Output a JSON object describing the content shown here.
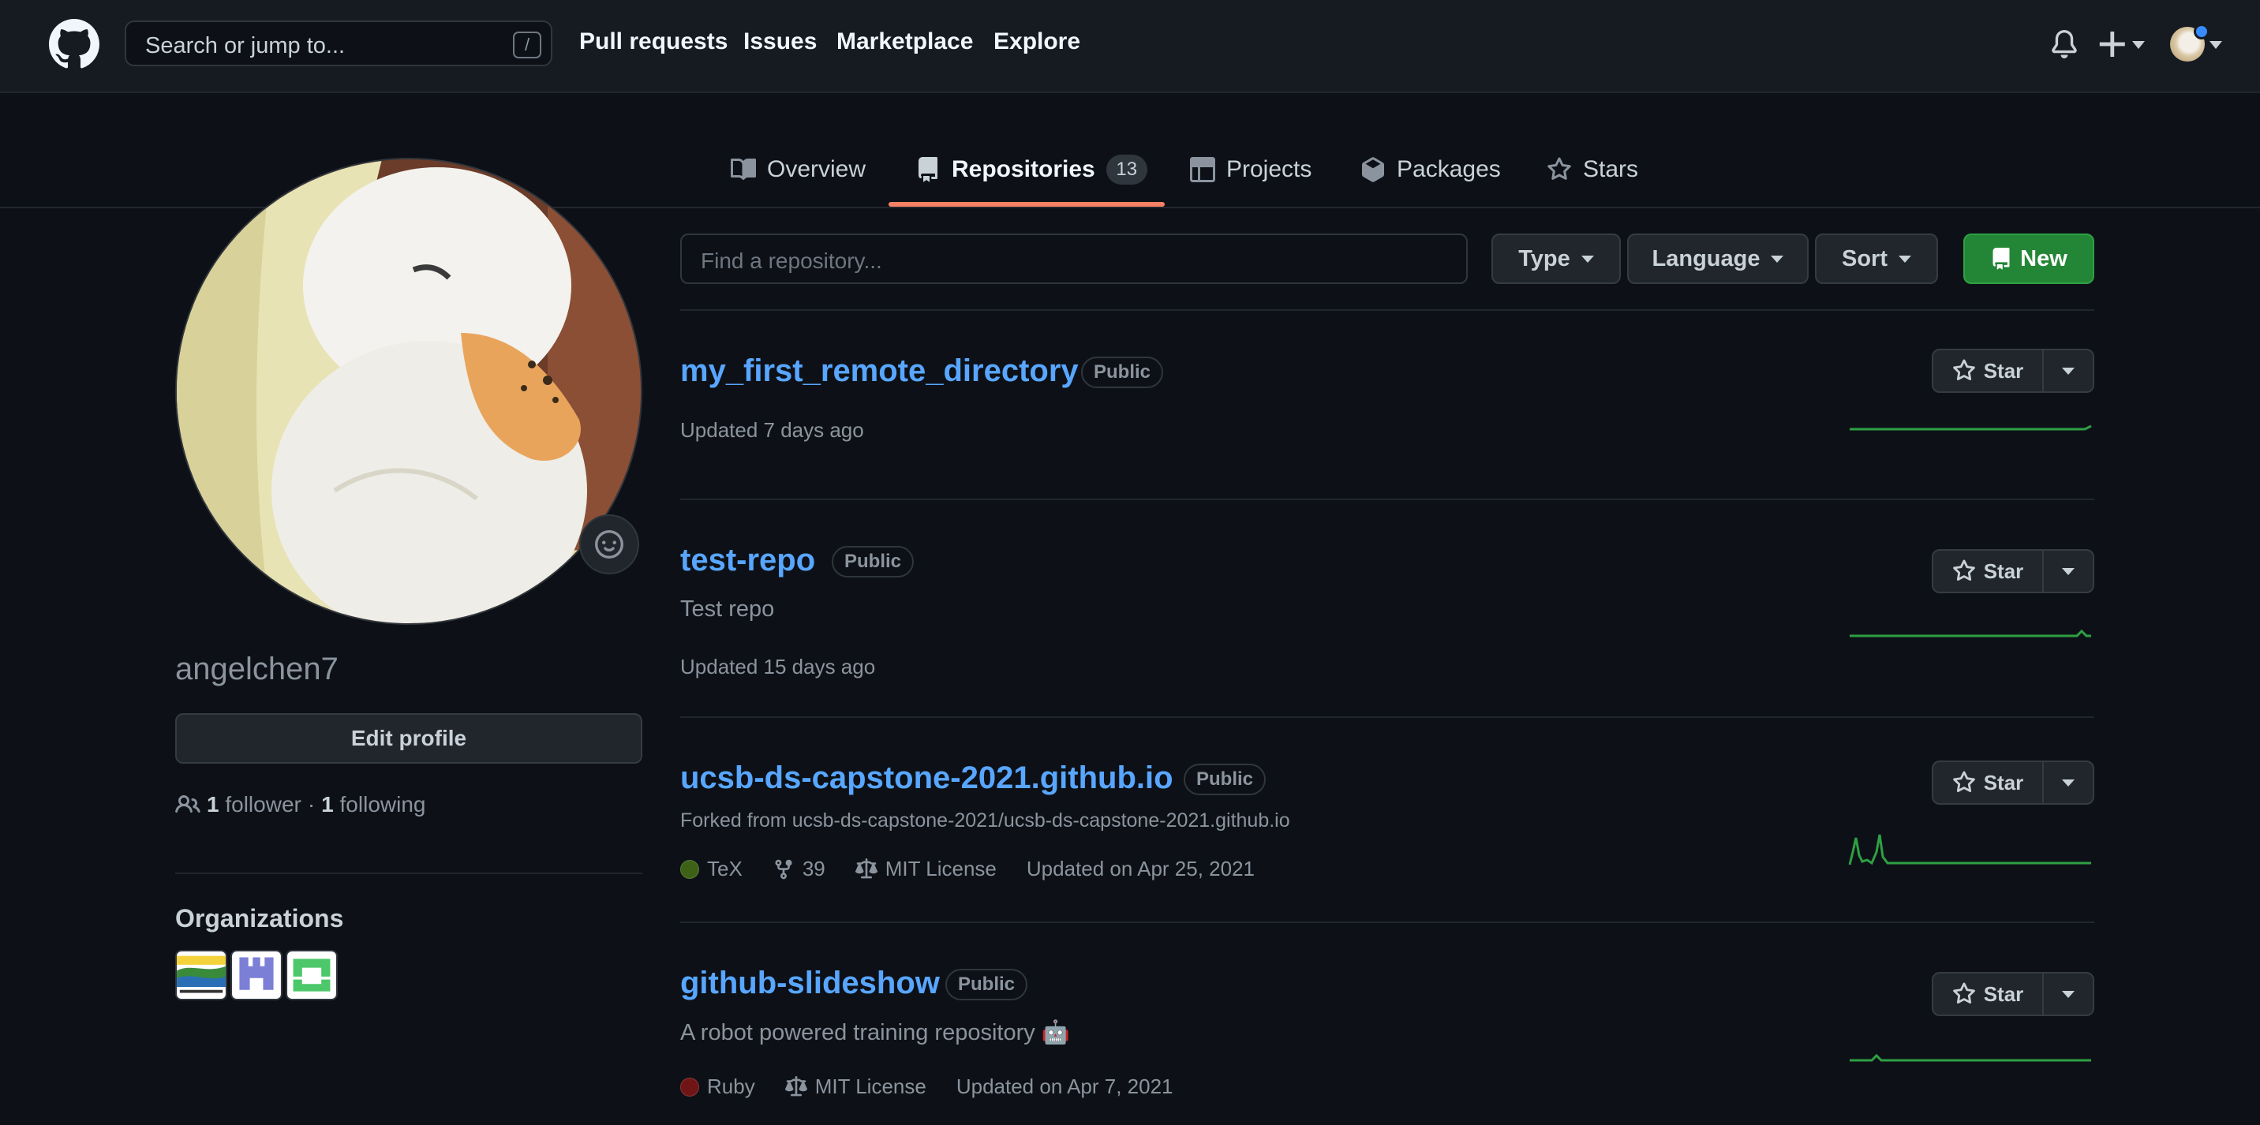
{
  "header": {
    "search_placeholder": "Search or jump to...",
    "search_shortcut": "/",
    "nav": [
      "Pull requests",
      "Issues",
      "Marketplace",
      "Explore"
    ]
  },
  "tabs": [
    {
      "label": "Overview",
      "icon": "book-icon"
    },
    {
      "label": "Repositories",
      "icon": "repo-icon",
      "count": "13",
      "active": true
    },
    {
      "label": "Projects",
      "icon": "table-icon"
    },
    {
      "label": "Packages",
      "icon": "package-icon"
    },
    {
      "label": "Stars",
      "icon": "star-icon"
    }
  ],
  "profile": {
    "username": "angelchen7",
    "edit_label": "Edit profile",
    "followers_count": "1",
    "followers_label": "follower",
    "separator": "·",
    "following_count": "1",
    "following_label": "following",
    "organizations_title": "Organizations"
  },
  "toolbar": {
    "find_placeholder": "Find a repository...",
    "type_label": "Type",
    "language_label": "Language",
    "sort_label": "Sort",
    "new_label": "New"
  },
  "repos": [
    {
      "name": "my_first_remote_directory",
      "visibility": "Public",
      "updated": "Updated 7 days ago",
      "star_label": "Star"
    },
    {
      "name": "test-repo",
      "visibility": "Public",
      "description": "Test repo",
      "updated": "Updated 15 days ago",
      "star_label": "Star"
    },
    {
      "name": "ucsb-ds-capstone-2021.github.io",
      "visibility": "Public",
      "forked_from": "Forked from ucsb-ds-capstone-2021/ucsb-ds-capstone-2021.github.io",
      "language": "TeX",
      "language_color": "#3D6117",
      "forks": "39",
      "license": "MIT License",
      "updated": "Updated on Apr 25, 2021",
      "star_label": "Star"
    },
    {
      "name": "github-slideshow",
      "visibility": "Public",
      "description": "A robot powered training repository 🤖",
      "language": "Ruby",
      "language_color": "#701516",
      "license": "MIT License",
      "updated": "Updated on Apr 7, 2021",
      "star_label": "Star"
    }
  ],
  "colors": {
    "link": "#58a6ff",
    "accent_tab": "#f78166",
    "new_button": "#238636",
    "sparkline": "#2ea043"
  }
}
